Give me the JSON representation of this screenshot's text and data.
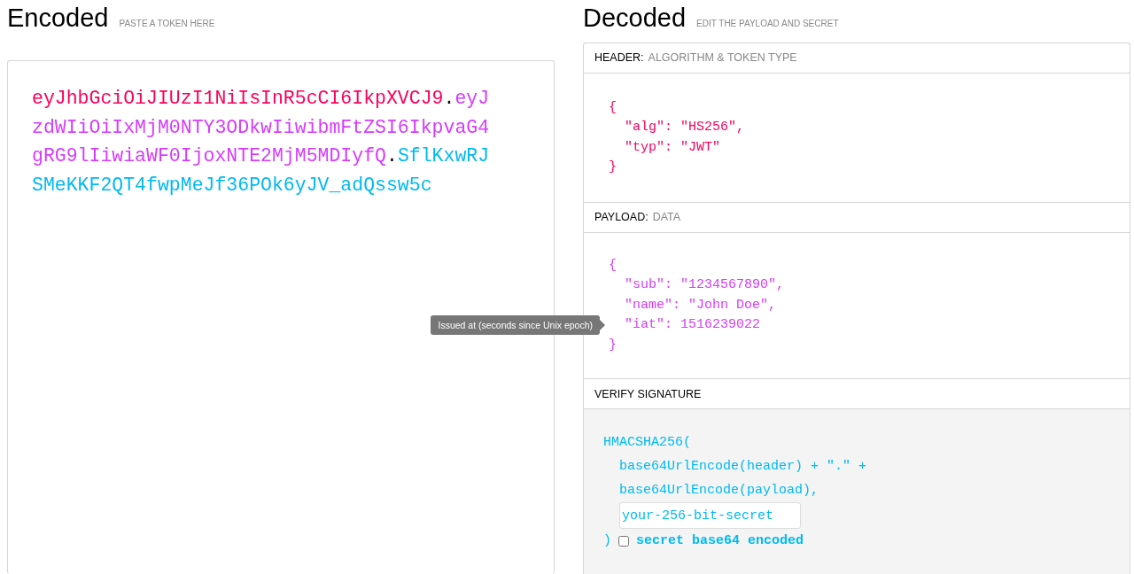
{
  "encoded": {
    "title": "Encoded",
    "hint": "PASTE A TOKEN HERE",
    "token": [
      {
        "kind": "part",
        "text": "eyJhbGciOiJIUzI1NiIsInR5cCI6IkpXVCJ9",
        "color": "#fb015b"
      },
      {
        "kind": "dot",
        "text": "."
      },
      {
        "kind": "part",
        "text": "eyJzdWIiOiIxMjM0NTY3ODkwIiwibmFtZSI6IkpvaG4gRG9lIiwiaWF0IjoxNTE2MjM5MDIyfQ",
        "color": "#d63aff"
      },
      {
        "kind": "dot",
        "text": "."
      },
      {
        "kind": "part",
        "text": "SflKxwRJSMeKKF2QT4fwpMeJf36POk6yJV_adQssw5c",
        "color": "#00b9f1"
      }
    ]
  },
  "decoded": {
    "title": "Decoded",
    "hint": "EDIT THE PAYLOAD AND SECRET",
    "sections": [
      {
        "kind": "json",
        "label": "HEADER:",
        "sublabel": "ALGORITHM & TOKEN TYPE",
        "color": "#fb015b",
        "lines": [
          {
            "kind": "brace",
            "text": "{"
          },
          {
            "kind": "entry",
            "text": "\"alg\": \"HS256\","
          },
          {
            "kind": "entry",
            "text": "\"typ\": \"JWT\""
          },
          {
            "kind": "brace",
            "text": "}"
          }
        ]
      },
      {
        "kind": "json",
        "label": "PAYLOAD:",
        "sublabel": "DATA",
        "color": "#d63aff",
        "lines": [
          {
            "kind": "brace",
            "text": "{"
          },
          {
            "kind": "entry",
            "text": "\"sub\": \"1234567890\","
          },
          {
            "kind": "entry",
            "text": "\"name\": \"John Doe\","
          },
          {
            "kind": "entry",
            "text": "\"iat\": 1516239022",
            "tooltip": "Issued at (seconds since Unix epoch)"
          },
          {
            "kind": "brace",
            "text": "}"
          }
        ]
      },
      {
        "kind": "verify",
        "label": "VERIFY SIGNATURE",
        "color": "#00b9f1",
        "lines": [
          "HMACSHA256(",
          "base64UrlEncode(header) + \".\" +",
          "base64UrlEncode(payload),"
        ],
        "secret": {
          "value": "your-256-bit-secret"
        },
        "close": ")",
        "checkbox": {
          "label": "secret base64 encoded",
          "checked": false
        }
      }
    ]
  }
}
